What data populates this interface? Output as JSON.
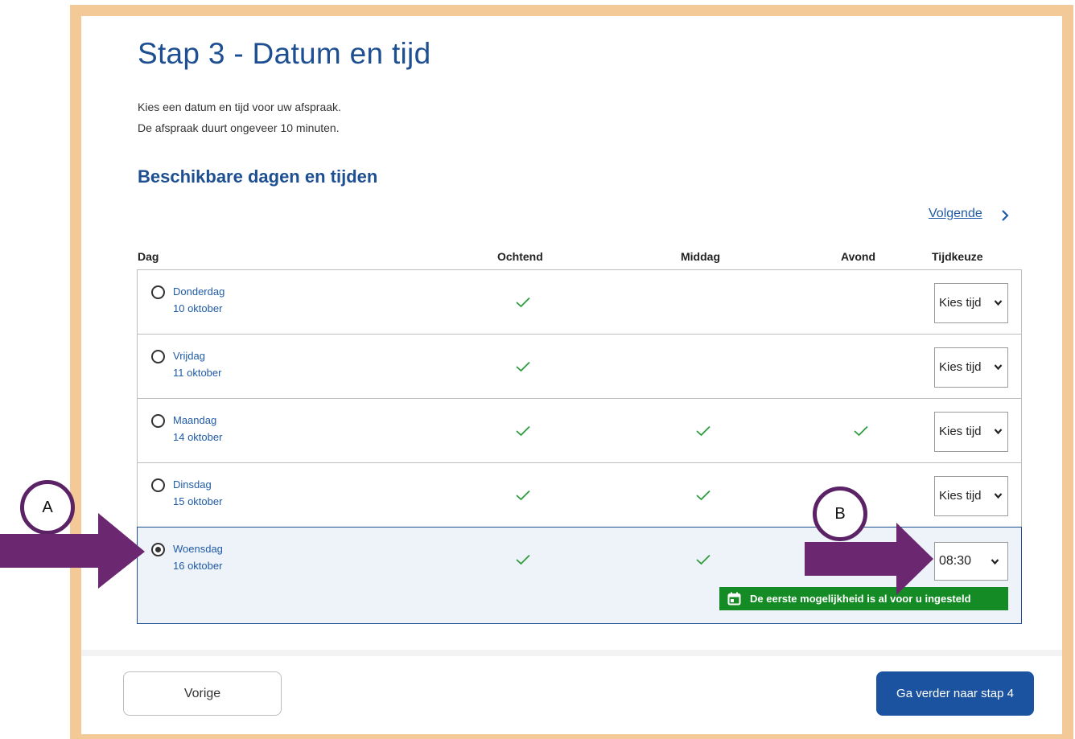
{
  "title": "Stap 3 - Datum en tijd",
  "intro": {
    "line1": "Kies een datum en tijd voor uw afspraak.",
    "line2": "De afspraak duurt ongeveer 10 minuten."
  },
  "subtitle": "Beschikbare dagen en tijden",
  "next_link": "Volgende",
  "headers": {
    "day": "Dag",
    "morning": "Ochtend",
    "afternoon": "Middag",
    "evening": "Avond",
    "time_choice": "Tijdkeuze"
  },
  "rows": [
    {
      "day": "Donderdag",
      "date": "10 oktober",
      "morning": true,
      "afternoon": false,
      "evening": false,
      "select": "Kies tijd",
      "selected": false
    },
    {
      "day": "Vrijdag",
      "date": "11 oktober",
      "morning": true,
      "afternoon": false,
      "evening": false,
      "select": "Kies tijd",
      "selected": false
    },
    {
      "day": "Maandag",
      "date": "14 oktober",
      "morning": true,
      "afternoon": true,
      "evening": true,
      "select": "Kies tijd",
      "selected": false
    },
    {
      "day": "Dinsdag",
      "date": "15 oktober",
      "morning": true,
      "afternoon": true,
      "evening": false,
      "select": "Kies tijd",
      "selected": false
    },
    {
      "day": "Woensdag",
      "date": "16 oktober",
      "morning": true,
      "afternoon": true,
      "evening": false,
      "select": "08:30",
      "selected": true
    }
  ],
  "tooltip": "De eerste mogelijkheid is al voor u ingesteld",
  "buttons": {
    "previous": "Vorige",
    "continue": "Ga verder naar stap 4"
  },
  "annotations": {
    "a": "A",
    "b": "B"
  },
  "colors": {
    "frame": "#f3c997",
    "heading": "#1d4f91",
    "link": "#1f5ba6",
    "check": "#2e9c3f",
    "tooltip_bg": "#158b25",
    "primary_button": "#1b53a0",
    "annotation": "#5b2366"
  }
}
